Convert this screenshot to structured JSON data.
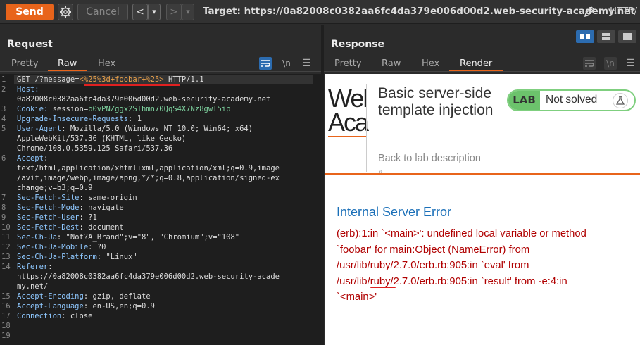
{
  "toolbar": {
    "send_label": "Send",
    "cancel_label": "Cancel",
    "back_glyph": "<",
    "back_dropdown_glyph": "▾",
    "forward_glyph": ">",
    "forward_dropdown_glyph": "▾",
    "target": "Target: https://0a82008c0382aa6fc4da379e006d00d2.web-security-academy.net",
    "protocol_truncated": "HTTP/"
  },
  "request": {
    "title": "Request",
    "tabs": [
      "Pretty",
      "Raw",
      "Hex"
    ],
    "active_tab": "Raw",
    "newline_toggle": "\\n",
    "lines": [
      {
        "n": "1",
        "parts": [
          {
            "t": "GET /?message=",
            "c": ""
          },
          {
            "t": "<%25%3d+foobar+%25>",
            "c": "payload"
          },
          {
            "t": " HTTP/1.1",
            "c": ""
          }
        ]
      },
      {
        "n": "2",
        "parts": [
          {
            "t": "Host:",
            "c": "hdr"
          }
        ]
      },
      {
        "n": "",
        "parts": [
          {
            "t": "0a82008c0382aa6fc4da379e006d00d2.web-security-academy.net",
            "c": ""
          }
        ]
      },
      {
        "n": "3",
        "parts": [
          {
            "t": "Cookie: ",
            "c": "hdr"
          },
          {
            "t": "session=",
            "c": ""
          },
          {
            "t": "b0vPNZggx2SIhmn70QqS4X7Nz8gwI5ip",
            "c": "cookie"
          }
        ]
      },
      {
        "n": "4",
        "parts": [
          {
            "t": "Upgrade-Insecure-Requests",
            "c": "hdr"
          },
          {
            "t": ": 1",
            "c": ""
          }
        ]
      },
      {
        "n": "5",
        "parts": [
          {
            "t": "User-Agent",
            "c": "hdr"
          },
          {
            "t": ": Mozilla/5.0 (Windows NT 10.0; Win64; x64)",
            "c": ""
          }
        ]
      },
      {
        "n": "",
        "parts": [
          {
            "t": "AppleWebKit/537.36 (KHTML, like Gecko)",
            "c": ""
          }
        ]
      },
      {
        "n": "",
        "parts": [
          {
            "t": "Chrome/108.0.5359.125 Safari/537.36",
            "c": ""
          }
        ]
      },
      {
        "n": "6",
        "parts": [
          {
            "t": "Accept",
            "c": "hdr"
          },
          {
            "t": ":",
            "c": ""
          }
        ]
      },
      {
        "n": "",
        "parts": [
          {
            "t": "text/html,application/xhtml+xml,application/xml;q=0.9,image",
            "c": ""
          }
        ]
      },
      {
        "n": "",
        "parts": [
          {
            "t": "/avif,image/webp,image/apng,*/*;q=0.8,application/signed-ex",
            "c": ""
          }
        ]
      },
      {
        "n": "",
        "parts": [
          {
            "t": "change;v=b3;q=0.9",
            "c": ""
          }
        ]
      },
      {
        "n": "7",
        "parts": [
          {
            "t": "Sec-Fetch-Site",
            "c": "hdr"
          },
          {
            "t": ": same-origin",
            "c": ""
          }
        ]
      },
      {
        "n": "8",
        "parts": [
          {
            "t": "Sec-Fetch-Mode",
            "c": "hdr"
          },
          {
            "t": ": navigate",
            "c": ""
          }
        ]
      },
      {
        "n": "9",
        "parts": [
          {
            "t": "Sec-Fetch-User",
            "c": "hdr"
          },
          {
            "t": ": ?1",
            "c": ""
          }
        ]
      },
      {
        "n": "10",
        "parts": [
          {
            "t": "Sec-Fetch-Dest",
            "c": "hdr"
          },
          {
            "t": ": document",
            "c": ""
          }
        ]
      },
      {
        "n": "11",
        "parts": [
          {
            "t": "Sec-Ch-Ua",
            "c": "hdr"
          },
          {
            "t": ": \"Not?A_Brand\";v=\"8\", \"Chromium\";v=\"108\"",
            "c": ""
          }
        ]
      },
      {
        "n": "12",
        "parts": [
          {
            "t": "Sec-Ch-Ua-Mobile",
            "c": "hdr"
          },
          {
            "t": ": ?0",
            "c": ""
          }
        ]
      },
      {
        "n": "13",
        "parts": [
          {
            "t": "Sec-Ch-Ua-Platform",
            "c": "hdr"
          },
          {
            "t": ": \"Linux\"",
            "c": ""
          }
        ]
      },
      {
        "n": "14",
        "parts": [
          {
            "t": "Referer",
            "c": "hdr"
          },
          {
            "t": ":",
            "c": ""
          }
        ]
      },
      {
        "n": "",
        "parts": [
          {
            "t": "https://0a82008c0382aa6fc4da379e006d00d2.web-security-acade",
            "c": ""
          }
        ]
      },
      {
        "n": "",
        "parts": [
          {
            "t": "my.net/",
            "c": ""
          }
        ]
      },
      {
        "n": "15",
        "parts": [
          {
            "t": "Accept-Encoding",
            "c": "hdr"
          },
          {
            "t": ": gzip, deflate",
            "c": ""
          }
        ]
      },
      {
        "n": "16",
        "parts": [
          {
            "t": "Accept-Language",
            "c": "hdr"
          },
          {
            "t": ": en-US,en;q=0.9",
            "c": ""
          }
        ]
      },
      {
        "n": "17",
        "parts": [
          {
            "t": "Connection",
            "c": "hdr"
          },
          {
            "t": ": close",
            "c": ""
          }
        ]
      },
      {
        "n": "18",
        "parts": []
      },
      {
        "n": "19",
        "parts": []
      }
    ]
  },
  "response": {
    "title": "Response",
    "tabs": [
      "Pretty",
      "Raw",
      "Hex",
      "Render"
    ],
    "active_tab": "Render",
    "newline_toggle": "\\n",
    "render": {
      "logo_text_line1": "Wel",
      "logo_text_line2": "Aca",
      "lab_title": "Basic server-side template injection",
      "back_link": "Back to lab description",
      "chevron": "»",
      "lab_badge_label": "LAB",
      "lab_status": "Not solved",
      "error_title": "Internal Server Error",
      "error_lines": [
        "(erb):1:in `<main>': undefined local variable or method",
        "`foobar' for main:Object (NameError) from",
        "/usr/lib/ruby/2.7.0/erb.rb:905:in `eval' from",
        "/usr/lib/ruby/2.7.0/erb.rb:905:in `result' from -e:4:in",
        "`<main>'"
      ]
    }
  },
  "colors": {
    "accent_orange": "#e8641b",
    "selected_blue": "#2c6cb0",
    "error_red": "#b00000",
    "error_title_blue": "#1a6fb8",
    "lab_green": "#6cc36c"
  }
}
